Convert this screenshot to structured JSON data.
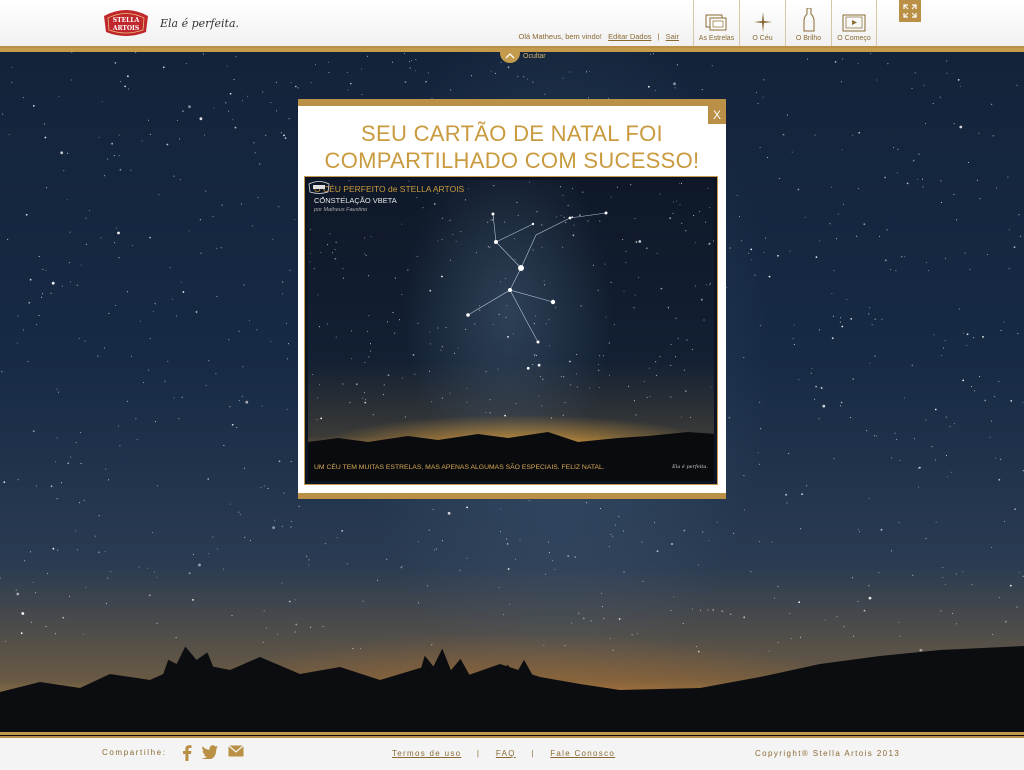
{
  "header": {
    "tagline": "Ela é perfeita.",
    "greeting": "Olá Matheus, bem vindo!",
    "edit_link": "Editar Dados",
    "separator": "|",
    "logout_link": "Sair"
  },
  "nav": {
    "items": [
      {
        "label": "As Estrelas",
        "icon": "stars-frames-icon"
      },
      {
        "label": "O Céu",
        "icon": "star-sparkle-icon"
      },
      {
        "label": "O Brilho",
        "icon": "bottle-icon"
      },
      {
        "label": "O Começo",
        "icon": "play-frame-icon"
      }
    ]
  },
  "toggle": {
    "label": "Ocultar"
  },
  "modal": {
    "close_label": "X",
    "title_line1": "SEU CARTÃO DE NATAL FOI",
    "title_line2": "COMPARTILHADO COM SUCESSO!",
    "card": {
      "heading": "O CÉU PERFEITO de STELLA ARTOIS",
      "subtitle": "CONSTELAÇÃO VBETA",
      "author": "por Matheus Faustino",
      "message": "UM CÉU TEM MUITAS ESTRELAS, MAS APENAS ALGUMAS SÃO ESPECIAIS. FELIZ NATAL.",
      "tagline": "Ela é perfeita."
    }
  },
  "footer": {
    "share_label": "Compartilhe:",
    "social": [
      "facebook-icon",
      "twitter-icon",
      "email-icon"
    ],
    "terms_link": "Termos de uso",
    "faq_link": "FAQ",
    "contact_link": "Fale Conosco",
    "separator": "|",
    "copyright": "Copyright® Stella Artois 2013"
  },
  "colors": {
    "gold": "#b99045",
    "title_gold": "#c99a3e",
    "sky": "#13233a"
  }
}
